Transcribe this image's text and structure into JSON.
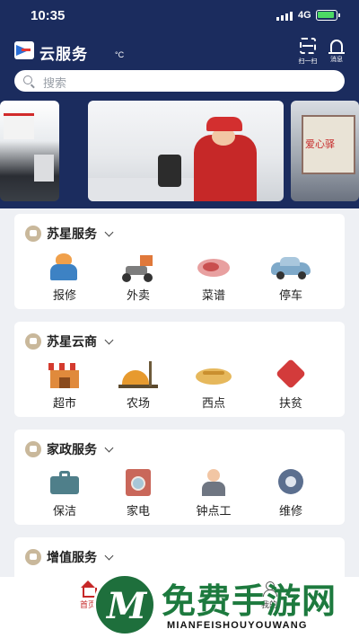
{
  "status_bar": {
    "time": "10:35",
    "network": "4G"
  },
  "header": {
    "app_title": "云服务",
    "temperature_unit": "°C",
    "scan_label": "扫一扫",
    "message_label": "消息"
  },
  "search": {
    "placeholder": "搜索"
  },
  "banner": {
    "right_text": "爱心驿"
  },
  "sections": [
    {
      "title": "苏星服务",
      "items": [
        {
          "label": "报修",
          "icon": "repair-worker-icon"
        },
        {
          "label": "外卖",
          "icon": "delivery-scooter-icon"
        },
        {
          "label": "菜谱",
          "icon": "recipe-meat-icon"
        },
        {
          "label": "停车",
          "icon": "car-icon"
        }
      ]
    },
    {
      "title": "苏星云商",
      "items": [
        {
          "label": "超市",
          "icon": "supermarket-icon"
        },
        {
          "label": "农场",
          "icon": "farm-icon"
        },
        {
          "label": "西点",
          "icon": "bread-icon"
        },
        {
          "label": "扶贫",
          "icon": "heart-hands-icon"
        }
      ]
    },
    {
      "title": "家政服务",
      "items": [
        {
          "label": "保洁",
          "icon": "toolbox-icon"
        },
        {
          "label": "家电",
          "icon": "washing-machine-icon"
        },
        {
          "label": "钟点工",
          "icon": "worker-icon"
        },
        {
          "label": "维修",
          "icon": "gear-icon"
        }
      ]
    },
    {
      "title": "增值服务"
    }
  ],
  "tabbar": {
    "home": "首页",
    "me": "我的"
  },
  "watermark": {
    "title": "免费手游网",
    "subtitle": "MIANFEISHOUYOUWANG"
  }
}
